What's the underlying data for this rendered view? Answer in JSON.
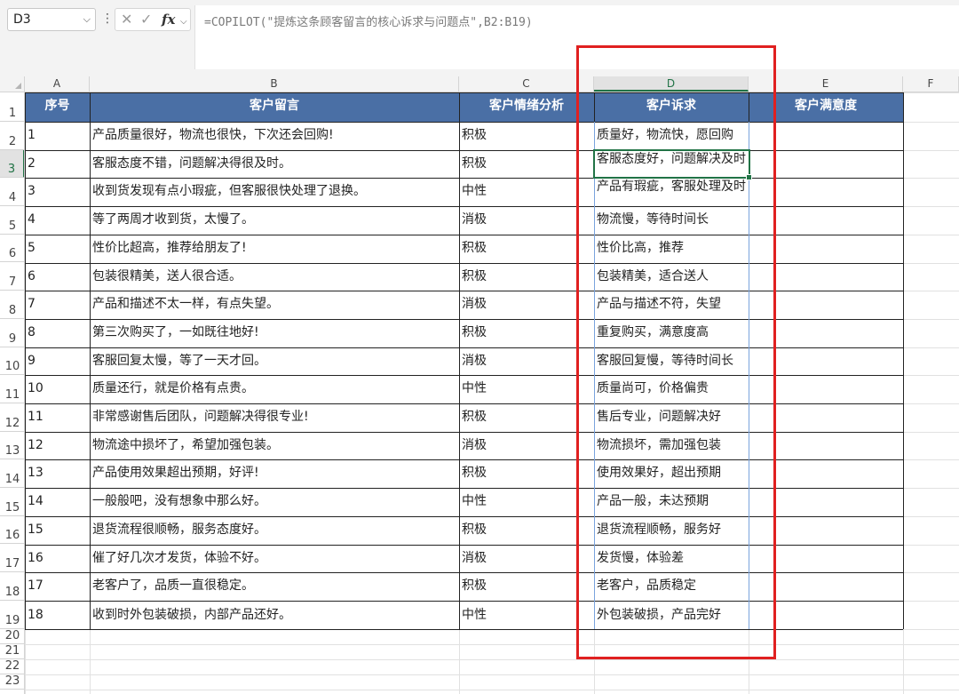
{
  "formula_bar": {
    "name_box": "D3",
    "formula": "=COPILOT(\"提炼这条顾客留言的核心诉求与问题点\",B2:B19)",
    "fx_label": "fx"
  },
  "columns": [
    "A",
    "B",
    "C",
    "D",
    "E",
    "F"
  ],
  "headers": [
    "序号",
    "客户留言",
    "客户情绪分析",
    "客户诉求",
    "客户满意度"
  ],
  "rows": [
    [
      "1",
      "产品质量很好，物流也很快，下次还会回购!",
      "积极",
      "质量好，物流快，愿回购"
    ],
    [
      "2",
      "客服态度不错，问题解决得很及时。",
      "积极",
      "客服态度好，问题解决及时"
    ],
    [
      "3",
      "收到货发现有点小瑕疵，但客服很快处理了退换。",
      "中性",
      "产品有瑕疵，客服处理及时"
    ],
    [
      "4",
      "等了两周才收到货，太慢了。",
      "消极",
      "物流慢，等待时间长"
    ],
    [
      "5",
      "性价比超高，推荐给朋友了!",
      "积极",
      "性价比高，推荐"
    ],
    [
      "6",
      "包装很精美，送人很合适。",
      "积极",
      "包装精美，适合送人"
    ],
    [
      "7",
      "产品和描述不太一样，有点失望。",
      "消极",
      "产品与描述不符，失望"
    ],
    [
      "8",
      "第三次购买了，一如既往地好!",
      "积极",
      "重复购买，满意度高"
    ],
    [
      "9",
      "客服回复太慢，等了一天才回。",
      "消极",
      "客服回复慢，等待时间长"
    ],
    [
      "10",
      "质量还行，就是价格有点贵。",
      "中性",
      "质量尚可，价格偏贵"
    ],
    [
      "11",
      "非常感谢售后团队，问题解决得很专业!",
      "积极",
      "售后专业，问题解决好"
    ],
    [
      "12",
      "物流途中损坏了，希望加强包装。",
      "消极",
      "物流损坏，需加强包装"
    ],
    [
      "13",
      "产品使用效果超出预期，好评!",
      "积极",
      "使用效果好，超出预期"
    ],
    [
      "14",
      "一般般吧，没有想象中那么好。",
      "中性",
      "产品一般，未达预期"
    ],
    [
      "15",
      "退货流程很顺畅，服务态度好。",
      "积极",
      "退货流程顺畅，服务好"
    ],
    [
      "16",
      "催了好几次才发货，体验不好。",
      "消极",
      "发货慢，体验差"
    ],
    [
      "17",
      "老客户了，品质一直很稳定。",
      "积极",
      "老客户，品质稳定"
    ],
    [
      "18",
      "收到时外包装破损，内部产品还好。",
      "中性",
      "外包装破损，产品完好"
    ]
  ],
  "row_numbers": [
    "1",
    "2",
    "3",
    "4",
    "5",
    "6",
    "7",
    "8",
    "9",
    "10",
    "11",
    "12",
    "13",
    "14",
    "15",
    "16",
    "17",
    "18",
    "19",
    "20",
    "21",
    "22",
    "23"
  ],
  "colors": {
    "header_bg": "#4a6fa5",
    "selection": "#217346",
    "highlight_box": "#e02020"
  }
}
